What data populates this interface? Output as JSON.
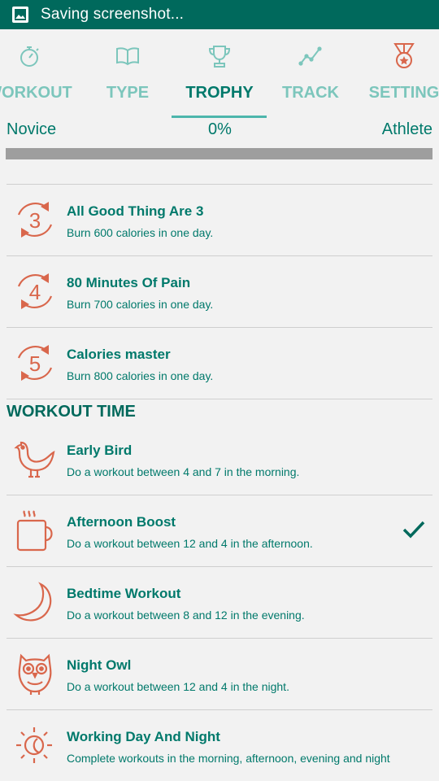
{
  "status_bar": {
    "text": "Saving screenshot...",
    "icon": "image-icon",
    "bg_color": "#00695c"
  },
  "tabs": [
    {
      "label": "WORKOUT",
      "icon": "stopwatch-icon",
      "active": false
    },
    {
      "label": "TYPE",
      "icon": "book-icon",
      "active": false
    },
    {
      "label": "TROPHY",
      "icon": "trophy-icon",
      "active": true
    },
    {
      "label": "TRACK",
      "icon": "line-chart-icon",
      "active": false
    },
    {
      "label": "SETTING",
      "icon": "medal-icon",
      "active": false
    }
  ],
  "progress": {
    "start_label": "Novice",
    "percent_label": "0%",
    "end_label": "Athlete",
    "value": 0
  },
  "calorie_trophies": [
    {
      "title": "All Good Thing Are 3",
      "desc": "Burn 600 calories in one day.",
      "icon": "cycle-3-icon",
      "number": "3"
    },
    {
      "title": "80 Minutes Of Pain",
      "desc": "Burn 700 calories in one day.",
      "icon": "cycle-4-icon",
      "number": "4"
    },
    {
      "title": "Calories master",
      "desc": "Burn 800 calories in one day.",
      "icon": "cycle-5-icon",
      "number": "5"
    }
  ],
  "workout_time": {
    "header": "WORKOUT TIME",
    "items": [
      {
        "title": "Early Bird",
        "desc": "Do a workout between 4 and 7 in the morning.",
        "icon": "bird-icon",
        "achieved": false
      },
      {
        "title": "Afternoon Boost",
        "desc": "Do a workout between 12 and 4 in the afternoon.",
        "icon": "coffee-mug-icon",
        "achieved": true
      },
      {
        "title": "Bedtime Workout",
        "desc": "Do a workout between 8 and 12 in the evening.",
        "icon": "moon-icon",
        "achieved": false
      },
      {
        "title": "Night Owl",
        "desc": "Do a workout between 12 and 4 in the night.",
        "icon": "owl-icon",
        "achieved": false
      },
      {
        "title": "Working Day And Night",
        "desc": "Complete workouts in the morning, afternoon, evening and night",
        "icon": "sun-moon-icon",
        "achieved": false
      }
    ]
  },
  "colors": {
    "accent": "#00796b",
    "icon": "#d9674c",
    "check": "#00695c"
  }
}
